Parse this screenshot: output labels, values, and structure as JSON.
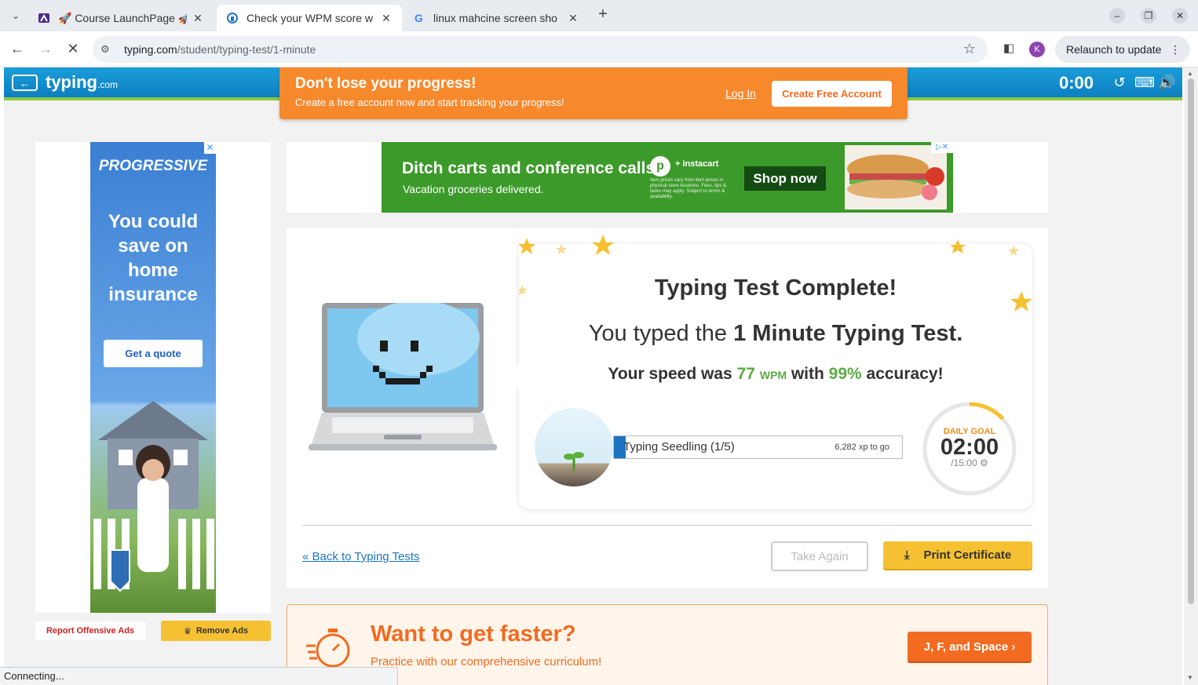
{
  "browser": {
    "tabs": [
      {
        "title": "🚀 Course LaunchPage 🚀",
        "icon": "tab-favicon-course",
        "active": false
      },
      {
        "title": "Check your WPM score w",
        "icon": "tab-favicon-typing",
        "active": true
      },
      {
        "title": "linux mahcine screen sho",
        "icon": "tab-favicon-google",
        "active": false
      }
    ],
    "new_tab": "+",
    "url_domain": "typing.com",
    "url_path": "/student/typing-test/1-minute",
    "relaunch_label": "Relaunch to update",
    "profile_initial": "K",
    "status_text": "Connecting..."
  },
  "topbar": {
    "logo": "typing",
    "logo_suffix": ".com",
    "timer": "0:00"
  },
  "promo": {
    "title": "Don't lose your progress!",
    "subtitle": "Create a free account now and start tracking your progress!",
    "login_label": "Log In",
    "create_label": "Create Free Account"
  },
  "side_ad": {
    "brand": "PROGRESSIVE",
    "headline": "You could save on home insurance",
    "cta": "Get a quote"
  },
  "ad_controls": {
    "report": "Report Offensive Ads",
    "remove": "Remove Ads"
  },
  "banner_ad": {
    "line1": "Ditch carts and conference calls.",
    "line2": "Vacation groceries delivered.",
    "brand": "+ instacart",
    "fine_print": "Item prices vary from item prices in physical store locations. Fees, tips & taxes may apply. Subject to terms & availability.",
    "cta": "Shop now"
  },
  "result": {
    "heading": "Typing Test Complete!",
    "typed_prefix": "You typed the ",
    "test_name": "1 Minute Typing Test.",
    "speed_prefix": "Your speed was ",
    "wpm_value": "77",
    "wpm_unit": "WPM",
    "with_label": " with ",
    "accuracy": "99%",
    "accuracy_suffix": " accuracy!",
    "level_label": "Typing Seedling (1/5)",
    "xp_to_go": "6,282 xp to go",
    "xp_progress": 0.04,
    "goal_label": "DAILY GOAL",
    "goal_time": "02:00",
    "goal_total": "/15:00",
    "goal_progress": 0.133
  },
  "actions": {
    "back_link": "« Back to Typing Tests",
    "take_again": "Take Again",
    "print": "Print Certificate"
  },
  "faster": {
    "title": "Want to get faster?",
    "subtitle": "Practice with our comprehensive curriculum!",
    "cta": "J, F, and Space ›"
  },
  "colors": {
    "accent_orange": "#f26b21",
    "typing_blue": "#1d75c2",
    "success_green": "#5aac44",
    "yellow_button": "#f5c132"
  }
}
